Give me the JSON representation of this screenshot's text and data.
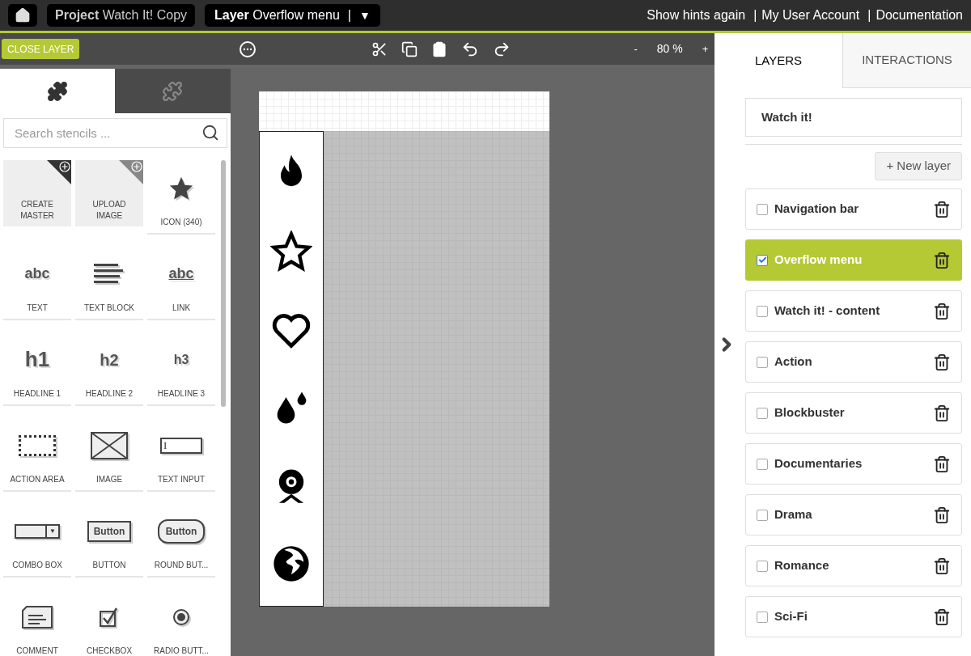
{
  "top_bar": {
    "project": "**Project** Watch It! Copy",
    "layer": "**Layer** Overflow menu",
    "layer_separator": "|",
    "layer_caret": "▼",
    "links": [
      {
        "label": "Show hints again"
      },
      {
        "separator": "|",
        "label": "My User Account"
      },
      {
        "separator": "|",
        "label": "Documentation"
      }
    ]
  },
  "toolbar": {
    "close_button": "CLOSE LAYER",
    "zoom_out": "-",
    "zoom": "80 %",
    "zoom_in": "+"
  },
  "stencil_tabs": [
    {
      "selected": true
    },
    {
      "selected": false
    }
  ],
  "search": {
    "placeholder": "Search stencils ..."
  },
  "stencils": [
    {
      "kind": "master",
      "label": "CREATE MASTER"
    },
    {
      "kind": "upload",
      "label": "UPLOAD IMAGE"
    },
    {
      "kind": "icon",
      "label": "ICON (340)"
    },
    {
      "kind": "text",
      "glyph": "abc",
      "label": "TEXT"
    },
    {
      "kind": "textblock",
      "label": "TEXT BLOCK"
    },
    {
      "kind": "link",
      "glyph": "abc",
      "label": "LINK"
    },
    {
      "kind": "h1",
      "glyph": "h1",
      "label": "HEADLINE 1"
    },
    {
      "kind": "h2",
      "glyph": "h2",
      "label": "HEADLINE 2"
    },
    {
      "kind": "h3",
      "glyph": "h3",
      "label": "HEADLINE 3"
    },
    {
      "kind": "actionarea",
      "label": "ACTION AREA"
    },
    {
      "kind": "image",
      "label": "IMAGE"
    },
    {
      "kind": "textinput",
      "glyph": "I",
      "label": "TEXT INPUT"
    },
    {
      "kind": "combobox",
      "glyph": "▼",
      "label": "COMBO BOX"
    },
    {
      "kind": "button",
      "glyph": "Button",
      "label": "BUTTON"
    },
    {
      "kind": "roundbutton",
      "glyph": "Button",
      "label": "ROUND BUT..."
    },
    {
      "kind": "comment",
      "label": "COMMENT"
    },
    {
      "kind": "checkbox",
      "label": "CHECKBOX"
    },
    {
      "kind": "radio",
      "label": "RADIO BUTT..."
    }
  ],
  "canvas": {
    "menu_icons": [
      {
        "kind": "flame"
      },
      {
        "kind": "star"
      },
      {
        "kind": "heart"
      },
      {
        "kind": "drops"
      },
      {
        "kind": "webcam"
      },
      {
        "kind": "globe"
      }
    ]
  },
  "panel_tabs": [
    {
      "label": "LAYERS",
      "selected": true
    },
    {
      "label": "INTERACTIONS",
      "selected": false
    }
  ],
  "page_name": "Watch it!",
  "new_layer_button": "+ New layer",
  "layers": [
    {
      "name": "Navigation bar",
      "selected": false
    },
    {
      "name": "Overflow menu",
      "selected": true
    },
    {
      "name": "Watch it! - content",
      "selected": false
    },
    {
      "name": "Action",
      "selected": false
    },
    {
      "name": "Blockbuster",
      "selected": false
    },
    {
      "name": "Documentaries",
      "selected": false
    },
    {
      "name": "Drama",
      "selected": false
    },
    {
      "name": "Romance",
      "selected": false
    },
    {
      "name": "Sci-Fi",
      "selected": false
    }
  ]
}
